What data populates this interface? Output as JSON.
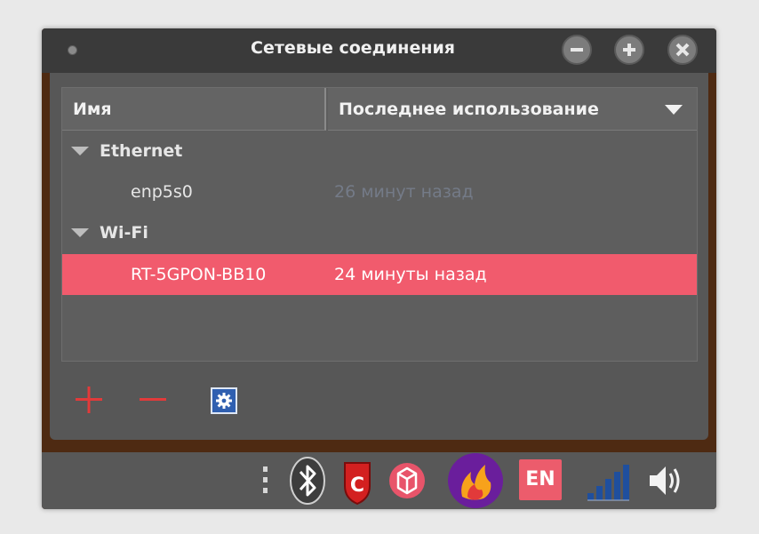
{
  "window": {
    "title": "Сетевые соединения",
    "buttons": [
      "minimize",
      "maximize",
      "close"
    ]
  },
  "table": {
    "columns": {
      "name": "Имя",
      "last_used": "Последнее использование"
    },
    "groups": [
      {
        "label": "Ethernet",
        "connections": [
          {
            "name": "enp5s0",
            "last_used": "26 минут назад",
            "state": "dim"
          }
        ]
      },
      {
        "label": "Wi-Fi",
        "connections": [
          {
            "name": "RT-5GPON-BB10",
            "last_used": "24 минуты назад",
            "state": "selected"
          }
        ]
      }
    ]
  },
  "actions": {
    "add_icon": "plus-icon",
    "remove_icon": "minus-icon",
    "settings_icon": "gear-icon"
  },
  "tray": {
    "icons": [
      "handle-icon",
      "bluetooth-icon",
      "shield-icon",
      "package-icon",
      "flame-app-icon",
      "keyboard-layout",
      "network-signal-icon",
      "volume-icon"
    ],
    "layout": "EN"
  },
  "colors": {
    "selection": "#f15b6d",
    "accent_red": "#e23a3a",
    "dim_text": "#747b88"
  }
}
